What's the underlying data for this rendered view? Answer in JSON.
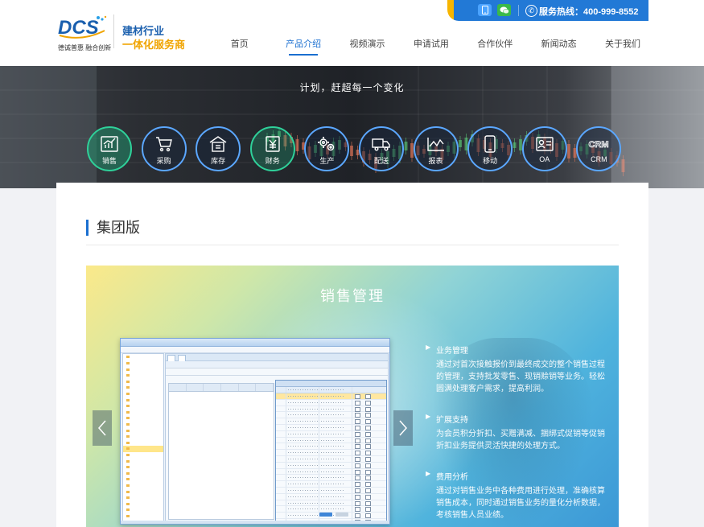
{
  "header": {
    "logo_text": "DCS",
    "logo_slogan": "德诚普惠 融合创新",
    "tagline_line1": "建材行业",
    "tagline_line2": "一体化服务商",
    "nav": [
      {
        "label": "首页",
        "active": false
      },
      {
        "label": "产品介绍",
        "active": true
      },
      {
        "label": "视频演示",
        "active": false
      },
      {
        "label": "申请试用",
        "active": false
      },
      {
        "label": "合作伙伴",
        "active": false
      },
      {
        "label": "新闻动态",
        "active": false
      },
      {
        "label": "关于我们",
        "active": false
      }
    ],
    "hotline": "服务热线：400-999-8552",
    "colors": {
      "brand_blue": "#1a5fae",
      "brand_orange": "#f0a400",
      "nav_active": "#1a6fd0",
      "hotline_bg": "#2279d6"
    }
  },
  "banner": {
    "slogan": "计划，赶超每一个变化",
    "modules": [
      {
        "label": "销售",
        "icon": "sales-chart-icon"
      },
      {
        "label": "采购",
        "icon": "cart-icon"
      },
      {
        "label": "库存",
        "icon": "warehouse-icon"
      },
      {
        "label": "财务",
        "icon": "yuan-icon"
      },
      {
        "label": "生产",
        "icon": "gears-icon"
      },
      {
        "label": "配送",
        "icon": "truck-icon"
      },
      {
        "label": "报表",
        "icon": "report-icon"
      },
      {
        "label": "移动",
        "icon": "mobile-icon"
      },
      {
        "label": "OA",
        "icon": "oa-icon"
      },
      {
        "label": "CRM",
        "icon": "crm-icon"
      }
    ]
  },
  "section": {
    "title": "集团版"
  },
  "slide": {
    "title": "销售管理",
    "features": [
      {
        "title": "业务管理",
        "desc": "通过对首次接触报价到最终成交的整个销售过程的管理，支持批发零售、现销赊销等业务。轻松圆满处理客户需求，提高利润。"
      },
      {
        "title": "扩展支持",
        "desc": "为会员积分折扣、买赠满减、捆绑式促销等促销折扣业务提供灵活快捷的处理方式。"
      },
      {
        "title": "费用分析",
        "desc": "通过对销售业务中各种费用进行处理，准确核算销售成本，同时通过销售业务的量化分析数据，考核销售人员业绩。"
      }
    ]
  }
}
